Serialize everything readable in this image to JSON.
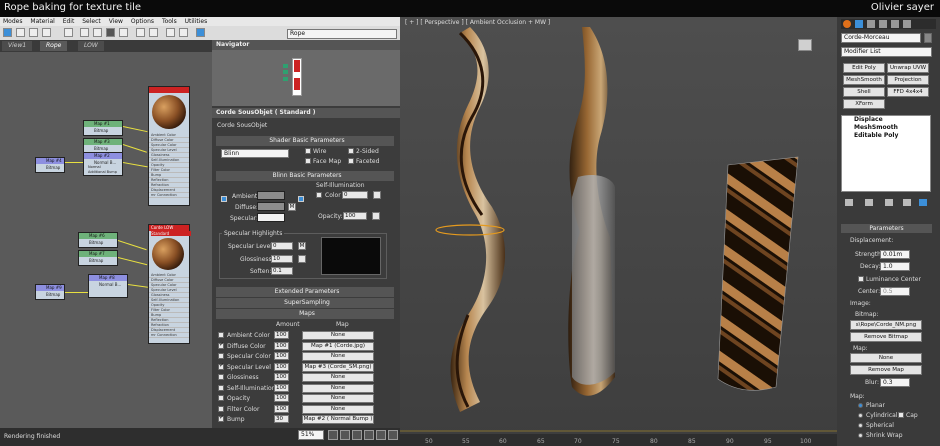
{
  "overlay": {
    "title_left": "Rope baking for texture tile",
    "title_right": "Olivier sayer"
  },
  "menu": [
    "Modes",
    "Material",
    "Edit",
    "Select",
    "View",
    "Options",
    "Tools",
    "Utilities"
  ],
  "material_selector": "Rope",
  "view_tabs": [
    "View1",
    "Rope",
    "LOW"
  ],
  "navigator": {
    "title": "Navigator"
  },
  "material": {
    "header": "Corde SousObjet  ( Standard )",
    "name": "Corde SousObjet",
    "shader_rollout": "Shader Basic Parameters",
    "shader": "Blinn",
    "wire": "Wire",
    "two_sided": "2-Sided",
    "face_map": "Face Map",
    "faceted": "Faceted",
    "blinn_rollout": "Blinn Basic Parameters",
    "self_illum": "Self-Illumination",
    "color_label": "Color",
    "color_value": "0",
    "ambient": "Ambient:",
    "diffuse": "Diffuse:",
    "specular": "Specular:",
    "m_label": "M",
    "opacity_label": "Opacity:",
    "opacity_value": "100",
    "spec_highlights": "Specular Highlights",
    "spec_level": "Specular Level:",
    "spec_level_value": "0",
    "glossiness": "Glossiness:",
    "glossiness_value": "10",
    "soften": "Soften:",
    "soften_value": "0.1",
    "extended": "Extended Parameters",
    "supersampling": "SuperSampling",
    "maps": "Maps",
    "amount_header": "Amount",
    "map_header": "Map"
  },
  "maps_rows": [
    {
      "name": "Ambient Color",
      "checked": false,
      "amount": "100",
      "map": "None"
    },
    {
      "name": "Diffuse Color",
      "checked": true,
      "amount": "100",
      "map": "Map #1 (Corde.jpg)"
    },
    {
      "name": "Specular Color",
      "checked": false,
      "amount": "100",
      "map": "None"
    },
    {
      "name": "Specular Level",
      "checked": true,
      "amount": "100",
      "map": "Map #3 (Corde_SM.png)"
    },
    {
      "name": "Glossiness",
      "checked": false,
      "amount": "100",
      "map": "None"
    },
    {
      "name": "Self-Illumination",
      "checked": false,
      "amount": "100",
      "map": "None"
    },
    {
      "name": "Opacity",
      "checked": false,
      "amount": "100",
      "map": "None"
    },
    {
      "name": "Filter Color",
      "checked": false,
      "amount": "100",
      "map": "None"
    },
    {
      "name": "Bump",
      "checked": true,
      "amount": "30",
      "map": "Map #2  ( Normal Bump )"
    }
  ],
  "status": {
    "text": "Rendering finished",
    "zoom": "51%"
  },
  "nodes": {
    "map1": "Map #1",
    "map1_sub": "Bitmap",
    "map2": "Map #2",
    "map2_sub": "Normal B...",
    "map3": "Map #3",
    "map3_sub": "Bitmap",
    "map4": "Map #4",
    "map4_sub": "Bitmap",
    "map5": "Map #5",
    "map5_sub": "Bitmap",
    "map6": "Map #6",
    "map6_sub": "Bitmap",
    "map7": "Map #7",
    "map7_sub": "Bitmap",
    "map8": "Map #8",
    "map8_sub": "Normal B...",
    "map9": "Map #9",
    "map9_sub": "Bitmap",
    "mat_low": "Corde LOW",
    "mat_low_sub": "Standard",
    "normal": "Normal",
    "additional_bump": "Additional Bump",
    "slots": [
      "Ambient Color",
      "Diffuse Color",
      "Specular Color",
      "Specular Level",
      "Glossiness",
      "Self-Illumination",
      "Opacity",
      "Filter Color",
      "Bump",
      "Reflection",
      "Refraction",
      "Displacement",
      "mr Connection"
    ]
  },
  "viewport": {
    "label": "[ + ] [ Perspective ] [ Ambient Occlusion + MW ]",
    "ruler": [
      "50",
      "55",
      "60",
      "65",
      "70",
      "75",
      "80",
      "85",
      "90",
      "95",
      "100"
    ]
  },
  "modify": {
    "object_name": "Corde-Morceau",
    "modifier_list": "Modifier List",
    "buttons": [
      "Edit Poly",
      "Unwrap UVW",
      "MeshSmooth",
      "Projection",
      "Shell",
      "FFD 4x4x4",
      "XForm"
    ],
    "stack": [
      "Displace",
      "MeshSmooth",
      "Editable Poly"
    ],
    "parameters": "Parameters",
    "displacement": "Displacement:",
    "strength_label": "Strength:",
    "strength": "0.01m",
    "decay_label": "Decay:",
    "decay": "1.0",
    "luminance_center": "Luminance Center",
    "center_label": "Center:",
    "center": "0.5",
    "image": "Image:",
    "bitmap_label": "Bitmap:",
    "bitmap": "s\\Rope\\Corde_NM.png",
    "remove_bitmap": "Remove Bitmap",
    "map_label": "Map:",
    "map_none": "None",
    "remove_map": "Remove Map",
    "blur_label": "Blur:",
    "blur": "0.3",
    "map2_label": "Map:",
    "planar": "Planar",
    "cylindrical": "Cylindrical",
    "cap": "Cap",
    "spherical": "Spherical",
    "shrink_wrap": "Shrink Wrap"
  }
}
